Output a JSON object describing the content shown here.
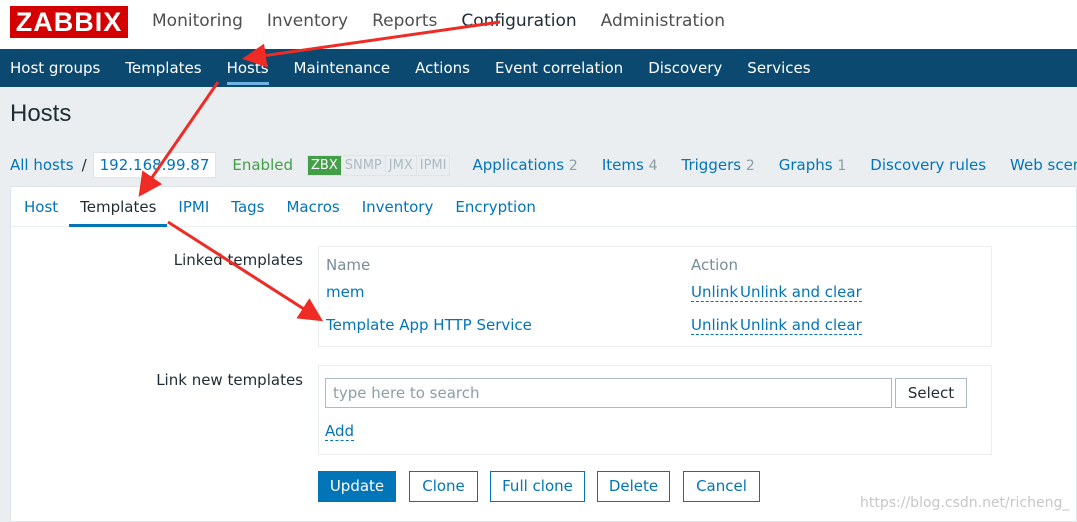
{
  "logo": "ZABBIX",
  "main_nav": [
    "Monitoring",
    "Inventory",
    "Reports",
    "Configuration",
    "Administration"
  ],
  "sub_nav": [
    "Host groups",
    "Templates",
    "Hosts",
    "Maintenance",
    "Actions",
    "Event correlation",
    "Discovery",
    "Services"
  ],
  "page_title": "Hosts",
  "host_bar": {
    "all_hosts": "All hosts",
    "separator": "/",
    "host_name": "192.168.99.87",
    "status": "Enabled",
    "availability": [
      "ZBX",
      "SNMP",
      "JMX",
      "IPMI"
    ],
    "links": [
      {
        "label": "Applications",
        "count": "2"
      },
      {
        "label": "Items",
        "count": "4"
      },
      {
        "label": "Triggers",
        "count": "2"
      },
      {
        "label": "Graphs",
        "count": "1"
      },
      {
        "label": "Discovery rules",
        "count": ""
      },
      {
        "label": "Web scenarios",
        "count": ""
      }
    ]
  },
  "tabs": [
    "Host",
    "Templates",
    "IPMI",
    "Tags",
    "Macros",
    "Inventory",
    "Encryption"
  ],
  "linked_templates": {
    "label": "Linked templates",
    "col_name": "Name",
    "col_action": "Action",
    "rows": [
      {
        "name": "mem",
        "unlink": "Unlink",
        "unlink_clear": "Unlink and clear"
      },
      {
        "name": "Template App HTTP Service",
        "unlink": "Unlink",
        "unlink_clear": "Unlink and clear"
      }
    ]
  },
  "link_new": {
    "label": "Link new templates",
    "placeholder": "type here to search",
    "select_label": "Select",
    "add_label": "Add"
  },
  "buttons": {
    "update": "Update",
    "clone": "Clone",
    "full_clone": "Full clone",
    "delete": "Delete",
    "cancel": "Cancel"
  },
  "watermark": "https://blog.csdn.net/richeng_",
  "colors": {
    "brand_red": "#d40000",
    "subnav_bg": "#0b4970",
    "link_blue": "#0275b8",
    "enabled_green": "#429e47",
    "annotation_red": "#ee2b24"
  }
}
